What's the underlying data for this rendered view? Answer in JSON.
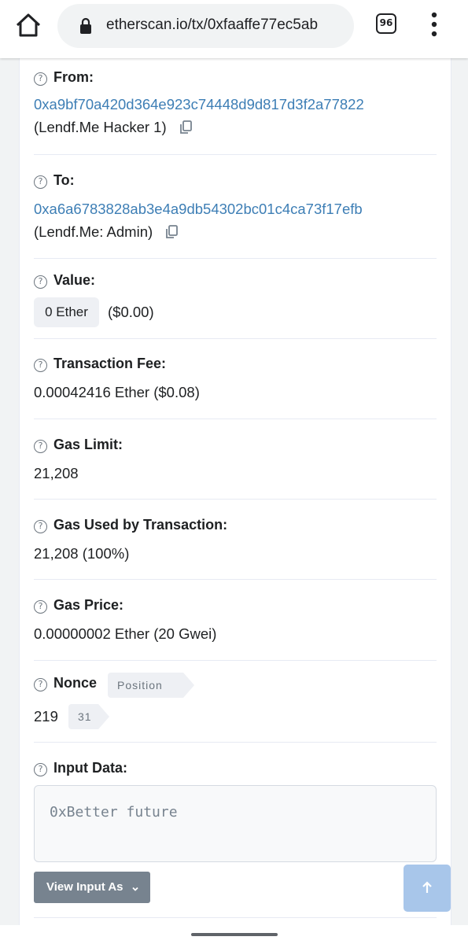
{
  "browser": {
    "url": "etherscan.io/tx/0xfaaffe77ec5ab",
    "tab_count": "96",
    "icons": [
      "home-icon",
      "lock-icon",
      "more-vert-icon"
    ]
  },
  "fields": {
    "from": {
      "label": "From:",
      "address": "0xa9bf70a420d364e923c74448d9d817d3f2a77822",
      "tag": "(Lendf.Me Hacker 1)"
    },
    "to": {
      "label": "To:",
      "address": "0xa6a6783828ab3e4a9db54302bc01c4ca73f17efb",
      "tag": "(Lendf.Me: Admin)"
    },
    "value": {
      "label": "Value:",
      "amount": "0 Ether",
      "usd": "($0.00)"
    },
    "fee": {
      "label": "Transaction Fee:",
      "value": "0.00042416 Ether ($0.08)"
    },
    "gas_limit": {
      "label": "Gas Limit:",
      "value": "21,208"
    },
    "gas_used": {
      "label": "Gas Used by Transaction:",
      "value": "21,208 (100%)"
    },
    "gas_price": {
      "label": "Gas Price:",
      "value": "0.00000002 Ether (20 Gwei)"
    },
    "nonce": {
      "label": "Nonce",
      "position_label": "Position",
      "value": "219",
      "position_value": "31"
    },
    "input": {
      "label": "Input Data:",
      "text": "0xBetter future",
      "view_button": "View Input As"
    }
  },
  "colors": {
    "link": "#3d7eb5",
    "button_gray": "#77838f",
    "scroll_top": "#a8c6ea"
  }
}
